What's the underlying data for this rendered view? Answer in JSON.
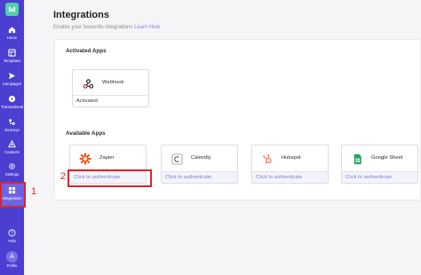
{
  "sidebar": {
    "items": [
      {
        "label": "Home",
        "icon": "home-icon"
      },
      {
        "label": "Templates",
        "icon": "templates-icon"
      },
      {
        "label": "Campaigns",
        "icon": "campaigns-icon"
      },
      {
        "label": "Transactional",
        "icon": "transactional-icon"
      },
      {
        "label": "Journeys",
        "icon": "journeys-icon"
      },
      {
        "label": "Contacts",
        "icon": "contacts-icon"
      },
      {
        "label": "Settings",
        "icon": "settings-icon"
      },
      {
        "label": "Integrations",
        "icon": "integrations-icon",
        "active": true
      },
      {
        "label": "Help",
        "icon": "help-icon"
      }
    ],
    "profile": {
      "label": "Profile",
      "initial": "A"
    }
  },
  "header": {
    "title": "Integrations",
    "subtitle": "Enable your favourite integrations",
    "learn_more": "Learn How"
  },
  "activated": {
    "heading": "Activated Apps",
    "apps": [
      {
        "name": "Webhook",
        "status": "Activated"
      }
    ]
  },
  "available": {
    "heading": "Available Apps",
    "apps": [
      {
        "name": "Zapier",
        "status": "Click to authenticate"
      },
      {
        "name": "Calendly",
        "status": "Click to authenticate"
      },
      {
        "name": "Hubspot",
        "status": "Click to authenticate"
      },
      {
        "name": "Google Sheet",
        "status": "Click to authenticate"
      }
    ]
  },
  "annotations": {
    "first": "1",
    "second": "2"
  },
  "colors": {
    "sidebar": "#4b3fd1",
    "accent": "#8a84e6",
    "highlight": "#d9252a"
  }
}
